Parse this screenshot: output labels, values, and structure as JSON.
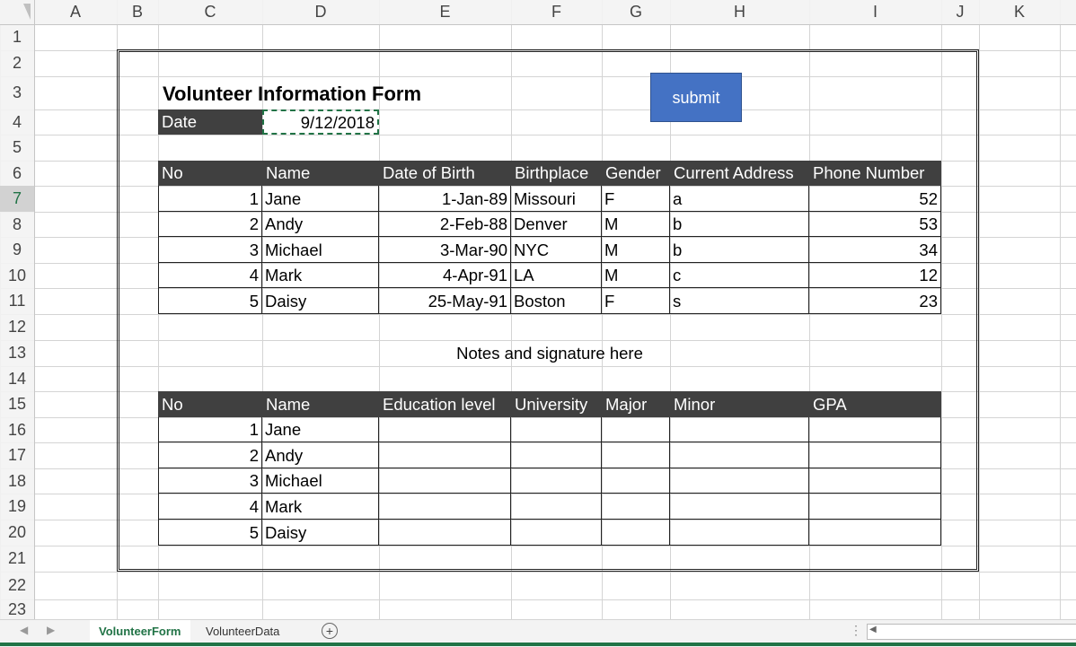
{
  "columns": [
    "A",
    "B",
    "C",
    "D",
    "E",
    "F",
    "G",
    "H",
    "I",
    "J",
    "K"
  ],
  "rows": [
    "1",
    "2",
    "3",
    "4",
    "5",
    "6",
    "7",
    "8",
    "9",
    "10",
    "11",
    "12",
    "13",
    "14",
    "15",
    "16",
    "17",
    "18",
    "19",
    "20",
    "21",
    "22",
    "23"
  ],
  "form": {
    "title": "Volunteer Information Form",
    "date_label": "Date",
    "date_value": "9/12/2018",
    "submit_label": "submit",
    "notes": "Notes and signature here"
  },
  "table1": {
    "headers": [
      "No",
      "Name",
      "Date of Birth",
      "Birthplace",
      "Gender",
      "Current Address",
      "Phone Number"
    ],
    "rows": [
      [
        "1",
        "Jane",
        "1-Jan-89",
        "Missouri",
        "F",
        "a",
        "52"
      ],
      [
        "2",
        "Andy",
        "2-Feb-88",
        "Denver",
        "M",
        "b",
        "53"
      ],
      [
        "3",
        "Michael",
        "3-Mar-90",
        "NYC",
        "M",
        "b",
        "34"
      ],
      [
        "4",
        "Mark",
        "4-Apr-91",
        "LA",
        "M",
        "c",
        "12"
      ],
      [
        "5",
        "Daisy",
        "25-May-91",
        "Boston",
        "F",
        "s",
        "23"
      ]
    ]
  },
  "table2": {
    "headers": [
      "No",
      "Name",
      "Education level",
      "University",
      "Major",
      "Minor",
      "GPA"
    ],
    "rows": [
      [
        "1",
        "Jane",
        "",
        "",
        "",
        "",
        ""
      ],
      [
        "2",
        "Andy",
        "",
        "",
        "",
        "",
        ""
      ],
      [
        "3",
        "Michael",
        "",
        "",
        "",
        "",
        ""
      ],
      [
        "4",
        "Mark",
        "",
        "",
        "",
        "",
        ""
      ],
      [
        "5",
        "Daisy",
        "",
        "",
        "",
        "",
        ""
      ]
    ]
  },
  "tabs": [
    "VolunteerForm",
    "VolunteerData"
  ],
  "active_tab": "VolunteerForm"
}
